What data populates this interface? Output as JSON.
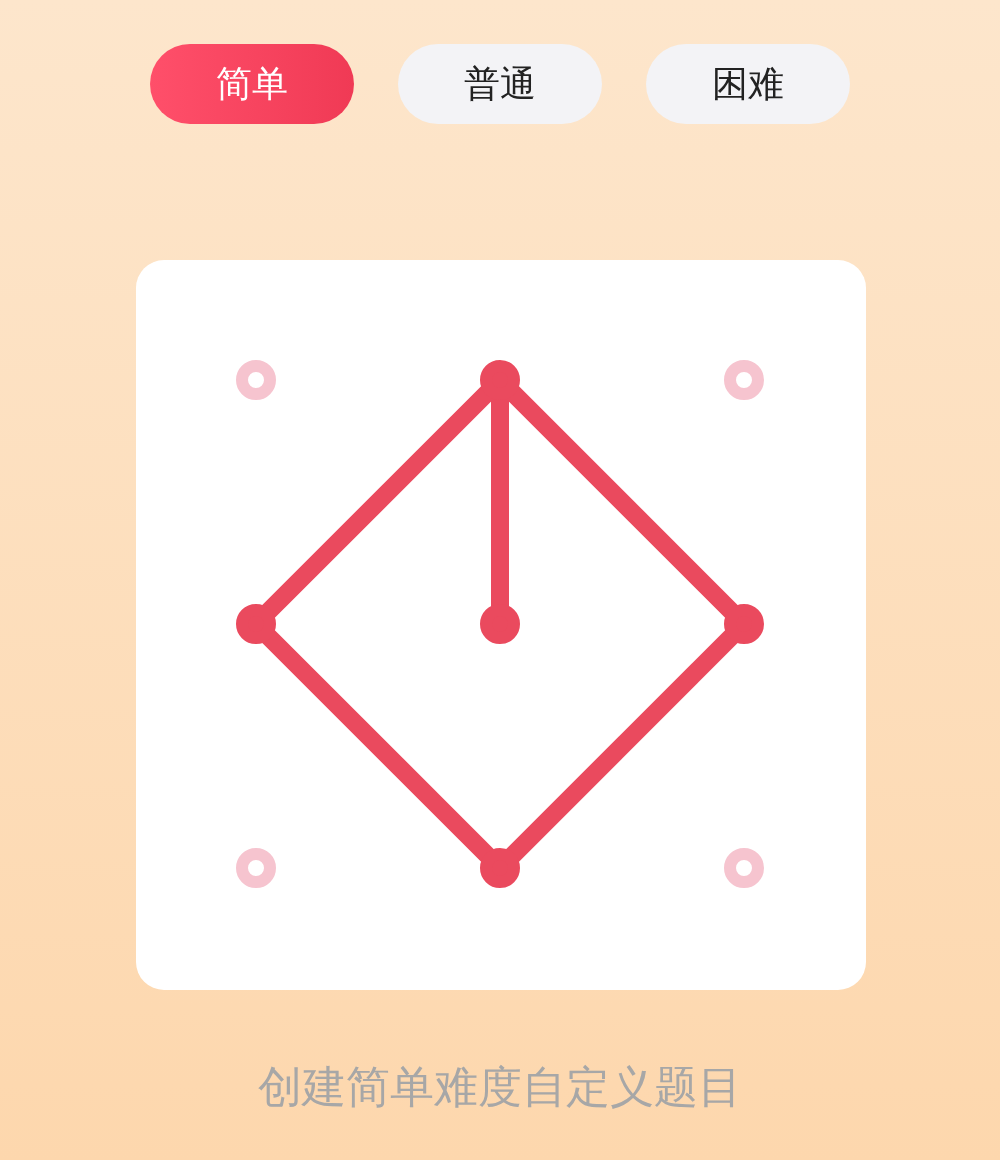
{
  "tabs": [
    {
      "label": "简单",
      "selected": true
    },
    {
      "label": "普通",
      "selected": false
    },
    {
      "label": "困难",
      "selected": false
    }
  ],
  "board": {
    "pegs": [
      {
        "selected": false
      },
      {
        "selected": true
      },
      {
        "selected": false
      },
      {
        "selected": true
      },
      {
        "selected": true
      },
      {
        "selected": true
      },
      {
        "selected": false
      },
      {
        "selected": true
      },
      {
        "selected": false
      }
    ]
  },
  "caption": "创建简单难度自定义题目"
}
